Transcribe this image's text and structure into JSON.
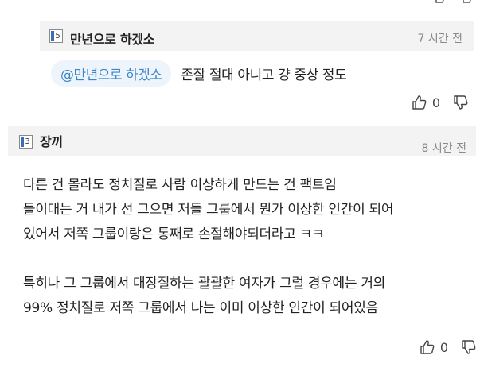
{
  "reply": {
    "author": "만년으로 하겠소",
    "level": "5",
    "time": "7 시간 전",
    "mention": "@만년으로 하겠소",
    "text": "존잘 절대 아니고 걍 중상 정도",
    "likes": "0"
  },
  "comment": {
    "author": "장끼",
    "level": "3",
    "time": "8 시간 전",
    "lines": [
      "다른 건 몰라도 정치질로 사람 이상하게 만드는 건 팩트임",
      "들이대는 거 내가 선 그으면 저들 그룹에서 뭔가 이상한 인간이 되어",
      "있어서 저쪽 그룹이랑은 통째로 손절해야되더라고 ㅋㅋ",
      "",
      "특히나 그 그룹에서 대장질하는 괄괄한 여자가 그럴 경우에는 거의",
      "99% 정치질로 저쪽 그룹에서 나는 이미 이상한 인간이 되어있음"
    ],
    "likes": "0"
  },
  "icons": {
    "like": "thumbs-up-icon",
    "dislike": "thumbs-down-icon"
  },
  "colors": {
    "mention_text": "#3c86c8",
    "mention_bg": "#eef4fb",
    "header_bg": "#f3f3f3",
    "time_text": "#8a8a8a",
    "badge_accent": "#3b6fb5"
  }
}
